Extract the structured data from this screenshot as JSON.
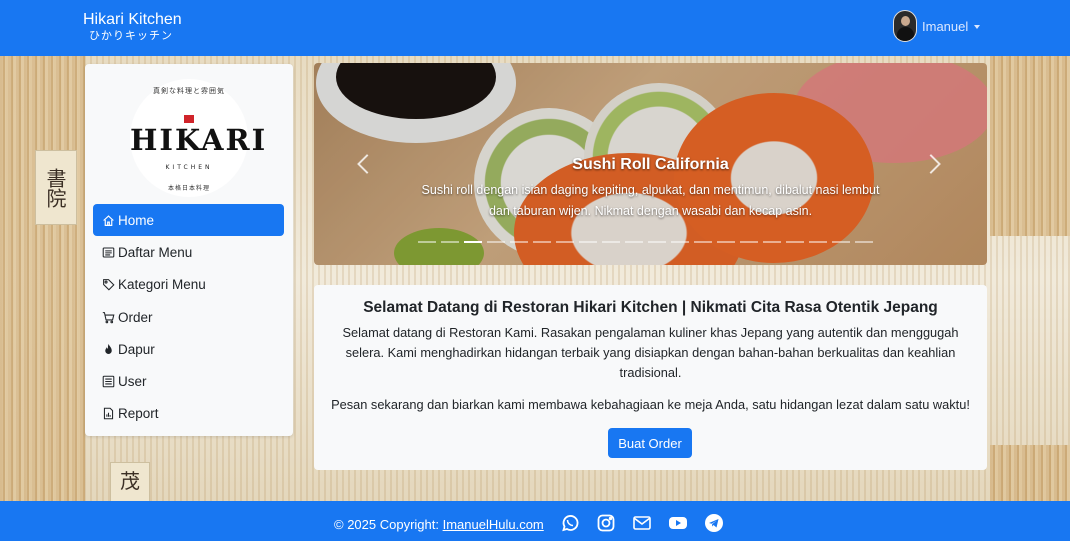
{
  "navbar": {
    "brand_title": "Hikari Kitchen",
    "brand_subtitle": "ひかりキッチン",
    "user_name": "Imanuel"
  },
  "background": {
    "scroll_text_1": "書院",
    "scroll_text_2": "茂庐"
  },
  "sidebar": {
    "logo": {
      "top_text": "真剣な料理と雰囲気",
      "word": "HIKARI",
      "small": "KITCHEN",
      "bottom_text": "本格日本料理",
      "mark_color": "#d0242a"
    },
    "items": [
      {
        "label": "Home",
        "icon": "house-icon",
        "active": true
      },
      {
        "label": "Daftar Menu",
        "icon": "menu-list-icon",
        "active": false
      },
      {
        "label": "Kategori Menu",
        "icon": "tag-icon",
        "active": false
      },
      {
        "label": "Order",
        "icon": "cart-icon",
        "active": false
      },
      {
        "label": "Dapur",
        "icon": "fire-icon",
        "active": false
      },
      {
        "label": "User",
        "icon": "user-list-icon",
        "active": false
      },
      {
        "label": "Report",
        "icon": "report-icon",
        "active": false
      }
    ]
  },
  "carousel": {
    "title": "Sushi Roll California",
    "description": "Sushi roll dengan isian daging kepiting, alpukat, dan mentimun, dibalut nasi lembut dan taburan wijen. Nikmat dengan wasabi dan kecap asin.",
    "slide_count": 20,
    "active_slide": 2
  },
  "welcome": {
    "title": "Selamat Datang di Restoran Hikari Kitchen | Nikmati Cita Rasa Otentik Jepang",
    "paragraph_1": "Selamat datang di Restoran Kami. Rasakan pengalaman kuliner khas Jepang yang autentik dan menggugah selera. Kami menghadirkan hidangan terbaik yang disiapkan dengan bahan-bahan berkualitas dan keahlian tradisional.",
    "paragraph_2": "Pesan sekarang dan biarkan kami membawa kebahagiaan ke meja Anda, satu hidangan lezat dalam satu waktu!",
    "button_label": "Buat Order"
  },
  "footer": {
    "copyright": "© 2025 Copyright: ",
    "link_text": "ImanuelHulu.com",
    "social_icons": [
      "whatsapp-icon",
      "instagram-icon",
      "email-icon",
      "youtube-icon",
      "telegram-icon"
    ]
  },
  "colors": {
    "primary": "#1877f2",
    "card_bg": "#f8f9fa"
  }
}
